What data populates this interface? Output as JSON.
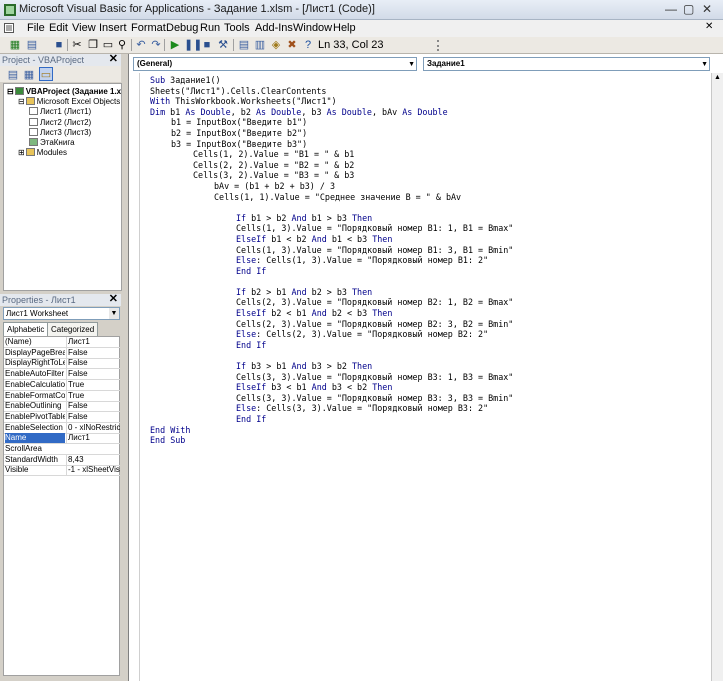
{
  "window": {
    "title": "Microsoft Visual Basic for Applications - Задание 1.xlsm - [Лист1 (Code)]"
  },
  "menu": [
    "File",
    "Edit",
    "View",
    "Insert",
    "Format",
    "Debug",
    "Run",
    "Tools",
    "Add-Ins",
    "Window",
    "Help"
  ],
  "toolbar": {
    "status": "Ln 33, Col 23"
  },
  "project": {
    "title": "Project - VBAProject",
    "tree": [
      {
        "label": "VBAProject (Задание 1.x",
        "level": 0,
        "icon": "project-icon",
        "bold": true
      },
      {
        "label": "Microsoft Excel Objects",
        "level": 1,
        "icon": "folder-icon",
        "bold": false
      },
      {
        "label": "Лист1 (Лист1)",
        "level": 2,
        "icon": "sheet-icon",
        "bold": false
      },
      {
        "label": "Лист2 (Лист2)",
        "level": 2,
        "icon": "sheet-icon",
        "bold": false
      },
      {
        "label": "Лист3 (Лист3)",
        "level": 2,
        "icon": "sheet-icon",
        "bold": false
      },
      {
        "label": "ЭтаКнига",
        "level": 2,
        "icon": "workbook-icon",
        "bold": false
      },
      {
        "label": "Modules",
        "level": 1,
        "icon": "folder-icon",
        "bold": false
      }
    ]
  },
  "properties": {
    "title": "Properties - Лист1",
    "object": "Лист1 Worksheet",
    "tabs": [
      "Alphabetic",
      "Categorized"
    ],
    "rows": [
      {
        "name": "(Name)",
        "value": "Лист1"
      },
      {
        "name": "DisplayPageBreak",
        "value": "False"
      },
      {
        "name": "DisplayRightToLef",
        "value": "False"
      },
      {
        "name": "EnableAutoFilter",
        "value": "False"
      },
      {
        "name": "EnableCalculation",
        "value": "True"
      },
      {
        "name": "EnableFormatCon",
        "value": "True"
      },
      {
        "name": "EnableOutlining",
        "value": "False"
      },
      {
        "name": "EnablePivotTable",
        "value": "False"
      },
      {
        "name": "EnableSelection",
        "value": "0 - xlNoRestrictio"
      },
      {
        "name": "Name",
        "value": "Лист1"
      },
      {
        "name": "ScrollArea",
        "value": ""
      },
      {
        "name": "StandardWidth",
        "value": "8,43"
      },
      {
        "name": "Visible",
        "value": "-1 - xlSheetVisib"
      }
    ]
  },
  "code_window": {
    "object_combo": "(General)",
    "proc_combo": "Задание1",
    "lines": [
      {
        "indent": 0,
        "text": "Sub Задание1()"
      },
      {
        "indent": 0,
        "text": "Sheets(\"Лист1\").Cells.ClearContents"
      },
      {
        "indent": 0,
        "text": "With ThisWorkbook.Worksheets(\"Лист1\")"
      },
      {
        "indent": 0,
        "text": "Dim b1 As Double, b2 As Double, b3 As Double, bAv As Double"
      },
      {
        "indent": 1,
        "text": "b1 = InputBox(\"Введите b1\")"
      },
      {
        "indent": 1,
        "text": "b2 = InputBox(\"Введите b2\")"
      },
      {
        "indent": 1,
        "text": "b3 = InputBox(\"Введите b3\")"
      },
      {
        "indent": 2,
        "text": "Cells(1, 2).Value = \"B1 = \" & b1"
      },
      {
        "indent": 2,
        "text": "Cells(2, 2).Value = \"B2 = \" & b2"
      },
      {
        "indent": 2,
        "text": "Cells(3, 2).Value = \"B3 = \" & b3"
      },
      {
        "indent": 3,
        "text": "bAv = (b1 + b2 + b3) / 3"
      },
      {
        "indent": 3,
        "text": "Cells(1, 1).Value = \"Среднее значение B = \" & bAv"
      },
      {
        "indent": 0,
        "text": ""
      },
      {
        "indent": 4,
        "text": "If b1 > b2 And b1 > b3 Then"
      },
      {
        "indent": 4,
        "text": "Cells(1, 3).Value = \"Порядковый номер B1: 1, B1 = Bmax\""
      },
      {
        "indent": 4,
        "text": "ElseIf b1 < b2 And b1 < b3 Then"
      },
      {
        "indent": 4,
        "text": "Cells(1, 3).Value = \"Порядковый номер B1: 3, B1 = Bmin\""
      },
      {
        "indent": 4,
        "text": "Else: Cells(1, 3).Value = \"Порядковый номер B1: 2\""
      },
      {
        "indent": 4,
        "text": "End If"
      },
      {
        "indent": 0,
        "text": ""
      },
      {
        "indent": 4,
        "text": "If b2 > b1 And b2 > b3 Then"
      },
      {
        "indent": 4,
        "text": "Cells(2, 3).Value = \"Порядковый номер B2: 1, B2 = Bmax\""
      },
      {
        "indent": 4,
        "text": "ElseIf b2 < b1 And b2 < b3 Then"
      },
      {
        "indent": 4,
        "text": "Cells(2, 3).Value = \"Порядковый номер B2: 3, B2 = Bmin\""
      },
      {
        "indent": 4,
        "text": "Else: Cells(2, 3).Value = \"Порядковый номер B2: 2\""
      },
      {
        "indent": 4,
        "text": "End If"
      },
      {
        "indent": 0,
        "text": ""
      },
      {
        "indent": 4,
        "text": "If b3 > b1 And b3 > b2 Then"
      },
      {
        "indent": 4,
        "text": "Cells(3, 3).Value = \"Порядковый номер B3: 1, B3 = Bmax\""
      },
      {
        "indent": 4,
        "text": "ElseIf b3 < b1 And b3 < b2 Then"
      },
      {
        "indent": 4,
        "text": "Cells(3, 3).Value = \"Порядковый номер B3: 3, B3 = Bmin\""
      },
      {
        "indent": 4,
        "text": "Else: Cells(3, 3).Value = \"Порядковый номер B3: 2\""
      },
      {
        "indent": 4,
        "text": "End If"
      },
      {
        "indent": 0,
        "text": "End With"
      },
      {
        "indent": 0,
        "text": "End Sub"
      }
    ]
  },
  "colors": {
    "keyword": "#00008b",
    "selection": "#316ac5"
  }
}
